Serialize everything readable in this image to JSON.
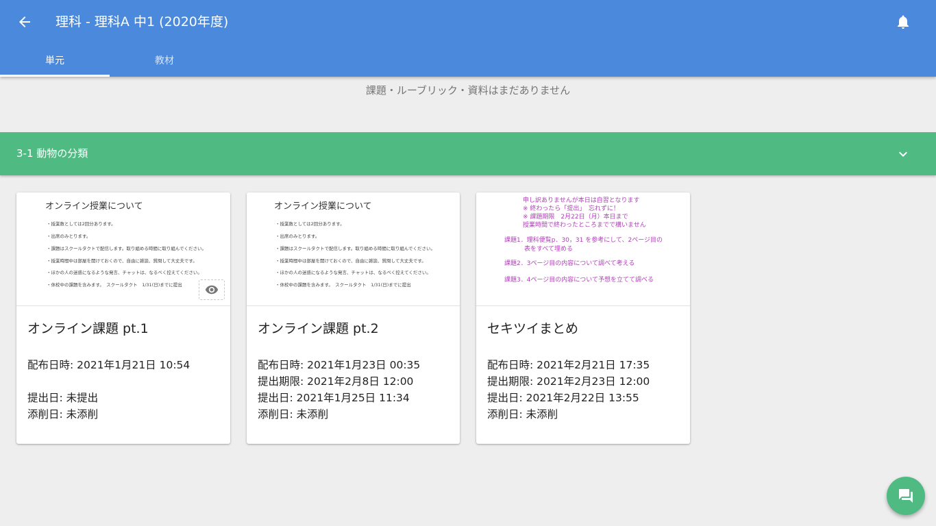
{
  "header": {
    "title": "理科 - 理科A 中1 (2020年度)",
    "back_icon": "arrow-back-icon",
    "notification_icon": "bell-icon",
    "bg_color": "#4a89dc"
  },
  "tabs": [
    {
      "label": "単元",
      "active": true
    },
    {
      "label": "教材",
      "active": false
    }
  ],
  "empty_message": "課題・ルーブリック・資料はまだありません",
  "unit": {
    "title": "3-1 動物の分類",
    "color": "#4fbb82"
  },
  "cards": [
    {
      "title": "オンライン課題 pt.1",
      "thumb": {
        "heading": "オンライン授業について",
        "lines": [
          "・授業数としては2回分あります。",
          "・出席のみとります。",
          "・課題はスクールタクトで配信します。取り組める時間に取り組んでください。",
          "・授業時間中は部屋を開けておくので、自由に雑談、質問して大丈夫です。",
          "・ほかの人の迷惑になるような発言、チャットは、なるべく控えてください。",
          "・休校中の課題を含みます。　スクールタクト　1/31(日)までに提出"
        ]
      },
      "info": {
        "distributed": "配布日時: 2021年1月21日 10:54",
        "deadline": "",
        "submitted": "提出日: 未提出",
        "corrected": "添削日: 未添削"
      }
    },
    {
      "title": "オンライン課題 pt.2",
      "thumb": {
        "heading": "オンライン授業について",
        "lines": [
          "・授業数としては2回分あります。",
          "・出席のみとります。",
          "・課題はスクールタクトで配信します。取り組める時間に取り組んでください。",
          "・授業時間中は部屋を開けておくので、自由に雑談、質問して大丈夫です。",
          "・ほかの人の迷惑になるような発言、チャットは、なるべく控えてください。",
          "・休校中の課題を含みます。　スクールタクト　1/31(日)までに提出"
        ]
      },
      "info": {
        "distributed": "配布日時: 2021年1月23日 00:35",
        "deadline": "提出期限: 2021年2月8日 12:00",
        "submitted": "提出日: 2021年1月25日 11:34",
        "corrected": "添削日: 未添削"
      }
    },
    {
      "title": "セキツイまとめ",
      "thumb": {
        "lines": [
          "申し訳ありませんが本日は自習となります",
          "※ 終わったら「提出」　忘れずに！",
          "※ 課題期限　2月22日（月）本日まで",
          "授業時間で終わったところまでで構いません",
          "課題1．理科便覧p．30，31 を参考にして、2ページ目の",
          "表をすべて埋める",
          "課題2．3ページ目の内容について調べて考える",
          "課題3．4ページ目の内容について予想を立てて調べる"
        ]
      },
      "info": {
        "distributed": "配布日時: 2021年2月21日 17:35",
        "deadline": "提出期限: 2021年2月23日 12:00",
        "submitted": "提出日: 2021年2月22日 13:55",
        "corrected": "添削日: 未添削"
      }
    }
  ],
  "preview_icon": "eye-icon",
  "fab_icon": "chat-icon"
}
